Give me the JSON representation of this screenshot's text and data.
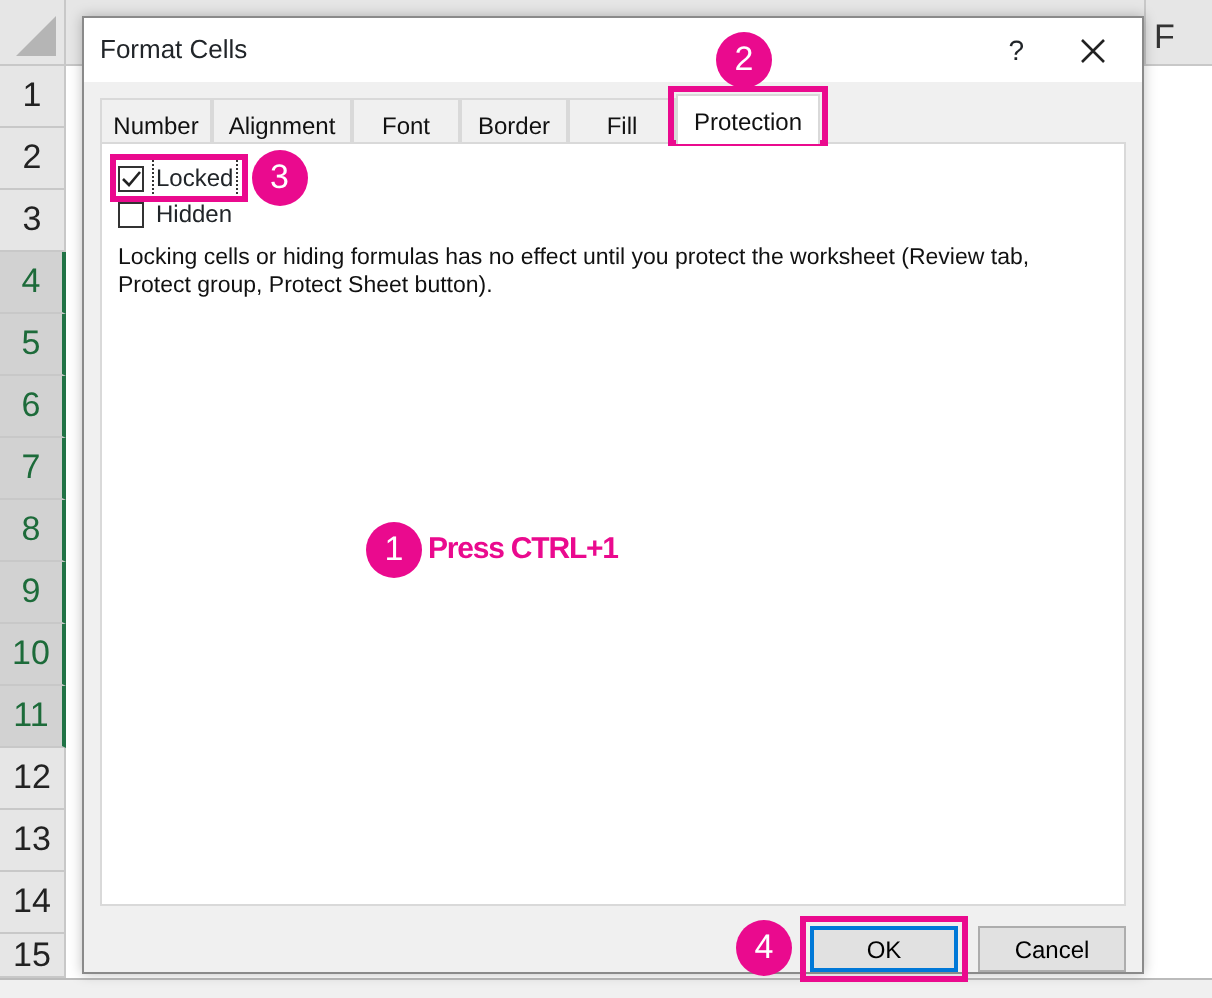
{
  "sheet": {
    "column_header": "F",
    "rows": [
      {
        "label": "1",
        "selected": false
      },
      {
        "label": "2",
        "selected": false
      },
      {
        "label": "3",
        "selected": false
      },
      {
        "label": "4",
        "selected": true
      },
      {
        "label": "5",
        "selected": true
      },
      {
        "label": "6",
        "selected": true
      },
      {
        "label": "7",
        "selected": true
      },
      {
        "label": "8",
        "selected": true
      },
      {
        "label": "9",
        "selected": true
      },
      {
        "label": "10",
        "selected": true
      },
      {
        "label": "11",
        "selected": true
      },
      {
        "label": "12",
        "selected": false
      },
      {
        "label": "13",
        "selected": false
      },
      {
        "label": "14",
        "selected": false
      },
      {
        "label": "15",
        "selected": false
      }
    ]
  },
  "dialog": {
    "title": "Format Cells",
    "help": "?",
    "tabs": [
      {
        "label": "Number",
        "selected": false,
        "highlighted": false
      },
      {
        "label": "Alignment",
        "selected": false,
        "highlighted": false
      },
      {
        "label": "Font",
        "selected": false,
        "highlighted": false
      },
      {
        "label": "Border",
        "selected": false,
        "highlighted": false
      },
      {
        "label": "Fill",
        "selected": false,
        "highlighted": false
      },
      {
        "label": "Protection",
        "selected": true,
        "highlighted": true,
        "callout": "2"
      }
    ],
    "checkboxes": [
      {
        "label": "Locked",
        "checked": true,
        "focused": true,
        "highlighted": true,
        "callout": "3"
      },
      {
        "label": "Hidden",
        "checked": false,
        "focused": false,
        "highlighted": false
      }
    ],
    "note": "Locking cells or hiding formulas has no effect until you protect the worksheet (Review tab, Protect group, Protect Sheet button).",
    "hint": {
      "callout": "1",
      "text": "Press CTRL+1"
    },
    "buttons": [
      {
        "label": "OK",
        "default": true,
        "highlighted": true,
        "callout": "4"
      },
      {
        "label": "Cancel",
        "default": false,
        "highlighted": false
      }
    ]
  }
}
